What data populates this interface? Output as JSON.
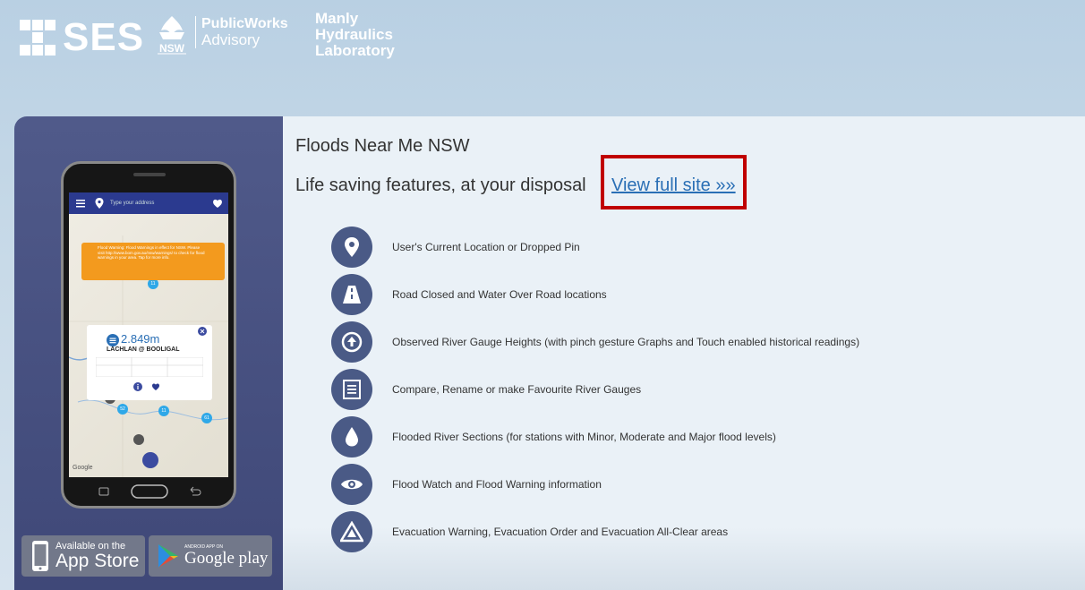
{
  "header": {
    "ses_logo": "SES",
    "nsw_logo": "NSW",
    "public_works": [
      "PublicWorks",
      "Advisory"
    ],
    "manly_hydraulics": [
      "Manly",
      "Hydraulics",
      "Laboratory"
    ]
  },
  "main": {
    "title": "Floods Near Me NSW",
    "subtitle_prefix": "Life saving features, at your disposal",
    "view_full_site": "View full site »»"
  },
  "features": [
    {
      "icon": "location-pin-icon",
      "label": "User's Current Location or Dropped Pin"
    },
    {
      "icon": "road-icon",
      "label": "Road Closed and Water Over Road locations"
    },
    {
      "icon": "up-arrow-circle-icon",
      "label": "Observed River Gauge Heights (with pinch gesture Graphs and Touch enabled historical readings)"
    },
    {
      "icon": "list-icon",
      "label": "Compare, Rename or make Favourite River Gauges"
    },
    {
      "icon": "water-drop-icon",
      "label": "Flooded River Sections (for stations with Minor, Moderate and Major flood levels)"
    },
    {
      "icon": "eye-icon",
      "label": "Flood Watch and Flood Warning information"
    },
    {
      "icon": "warning-triangle-icon",
      "label": "Evacuation Warning, Evacuation Order and Evacuation All-Clear areas"
    }
  ],
  "phone": {
    "address_placeholder": "Type your address",
    "warning_text": "Flood Warning: Flood Warnings in effect for NSW. Please visit http://www.bom.gov.au/nsw/warnings/ to check for flood warnings in your area. Tap for more info.",
    "gauge_value": "2.849m",
    "gauge_name": "LACHLAN @ BOOLIGAL",
    "google": "Google",
    "pins": [
      "11",
      "52",
      "11",
      "61",
      "12"
    ]
  },
  "stores": {
    "app_store_small": "Available on the",
    "app_store_big": "App Store",
    "google_small": "ANDROID APP ON",
    "google_big": "Google play"
  },
  "colors": {
    "accent": "#4a5a86",
    "link": "#2a6fb5",
    "highlight": "#c00000",
    "warning": "#f39a1e"
  }
}
